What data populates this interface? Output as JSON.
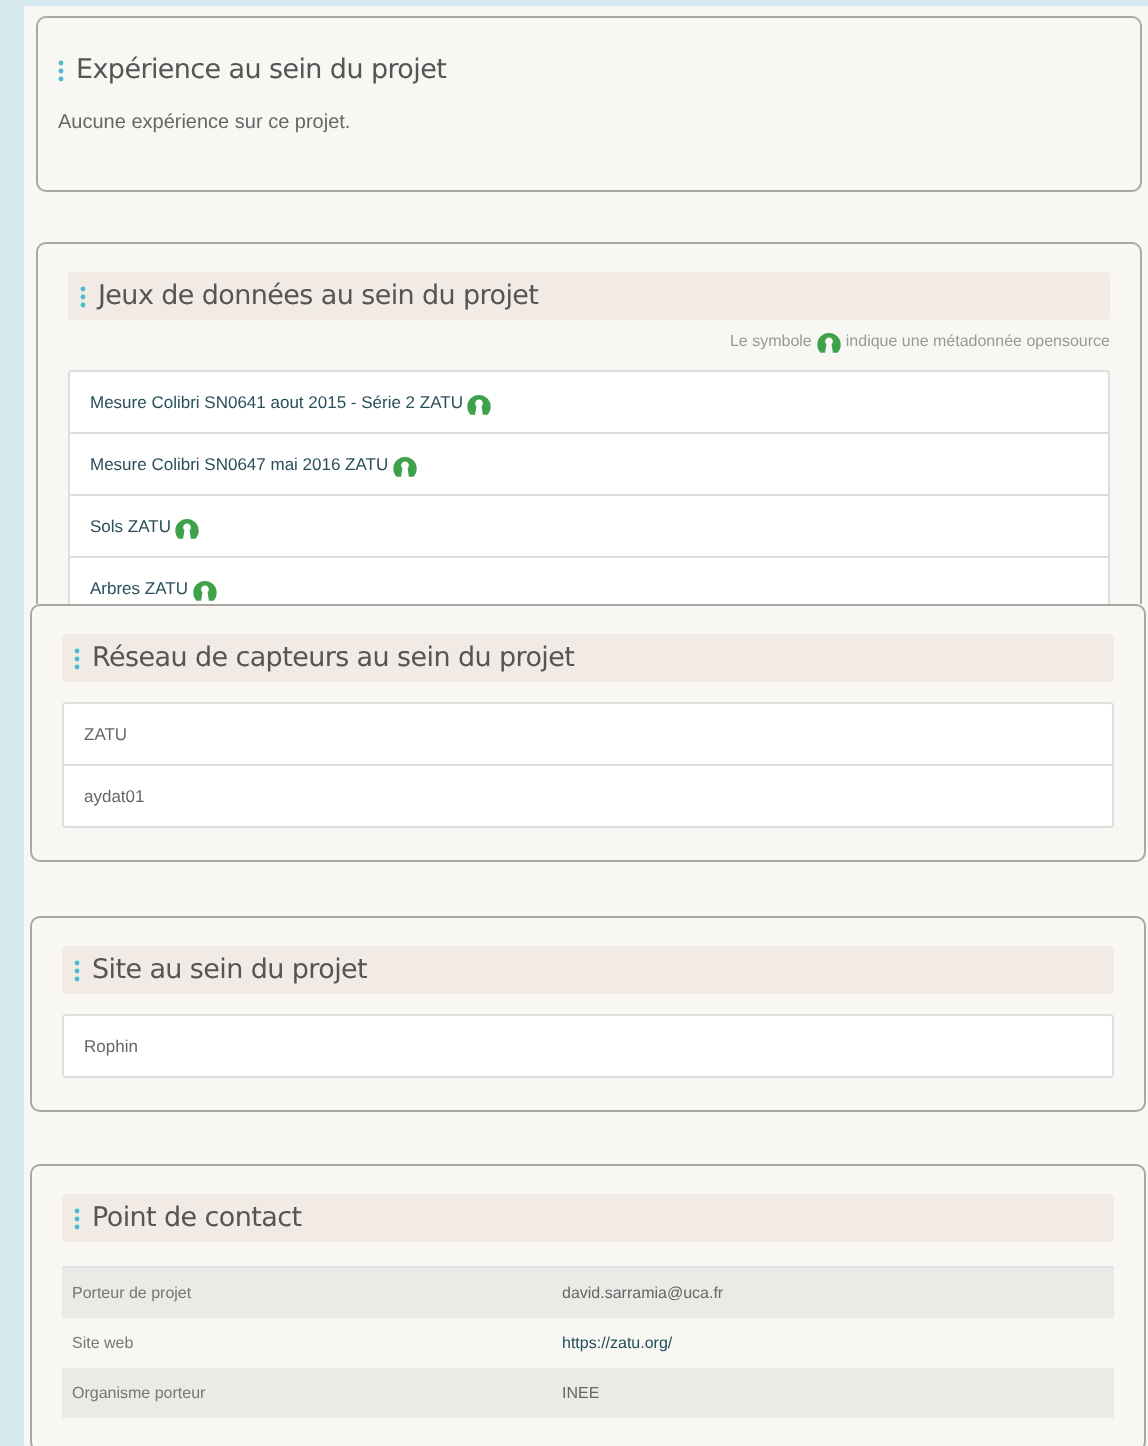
{
  "sections": [
    {
      "kind": "text",
      "title": "Expérience au sein du projet",
      "text": "Aucune expérience sur ce projet."
    },
    {
      "kind": "datasets",
      "title": "Jeux de données au sein du projet",
      "legend": {
        "before": "Le symbole",
        "after": "indique une métadonnée opensource"
      },
      "items": [
        {
          "label": "Mesure Colibri SN0641 aout 2015 - Série 2 ZATU",
          "opensource": true
        },
        {
          "label": "Mesure Colibri SN0647 mai 2016 ZATU",
          "opensource": true
        },
        {
          "label": "Sols ZATU",
          "opensource": true
        },
        {
          "label": "Arbres ZATU",
          "opensource": true
        }
      ]
    },
    {
      "kind": "list",
      "title": "Réseau de capteurs au sein du projet",
      "items": [
        "ZATU",
        "aydat01"
      ]
    },
    {
      "kind": "list",
      "title": "Site au sein du projet",
      "items": [
        "Rophin"
      ]
    },
    {
      "kind": "table",
      "title": "Point de contact",
      "rows": [
        {
          "label": "Porteur de projet",
          "value": "david.sarramia@uca.fr",
          "link": false
        },
        {
          "label": "Site web",
          "value": "https://zatu.org/",
          "link": true
        },
        {
          "label": "Organisme porteur",
          "value": "INEE",
          "link": false
        }
      ]
    }
  ]
}
